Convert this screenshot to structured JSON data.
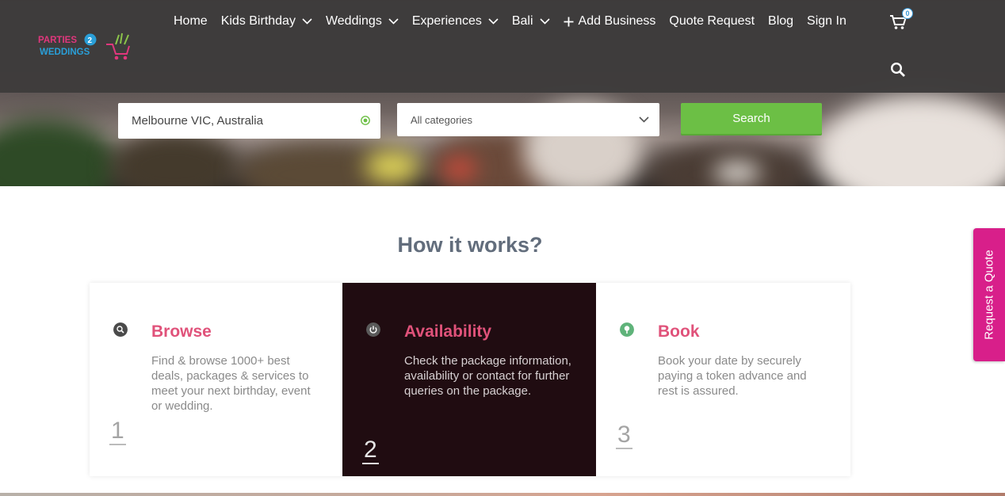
{
  "header": {
    "logo_top": "PARTIES",
    "logo_mid": "2",
    "logo_bottom": "WEDDINGS",
    "nav": [
      {
        "label": "Home",
        "dropdown": false
      },
      {
        "label": "Kids Birthday",
        "dropdown": true
      },
      {
        "label": "Weddings",
        "dropdown": true
      },
      {
        "label": "Experiences",
        "dropdown": true
      },
      {
        "label": "Bali",
        "dropdown": true
      },
      {
        "label": "Add Business",
        "dropdown": false,
        "icon": "plus-icon"
      },
      {
        "label": "Quote Request",
        "dropdown": false
      },
      {
        "label": "Blog",
        "dropdown": false
      },
      {
        "label": "Sign In",
        "dropdown": false
      }
    ],
    "cart_count": "0"
  },
  "search": {
    "location_value": "Melbourne VIC, Australia",
    "category_value": "All categories",
    "button_label": "Search"
  },
  "how_it_works": {
    "title": "How it works?",
    "steps": [
      {
        "title": "Browse",
        "text": "Find & browse 1000+ best deals, packages & services to meet your next birthday, event or wedding.",
        "number": "1",
        "icon": "search-icon"
      },
      {
        "title": "Availability",
        "text": "Check the package information, availability or contact for further queries on the package.",
        "number": "2",
        "icon": "power-icon"
      },
      {
        "title": "Book",
        "text": "Book your date by securely paying a token advance and rest is assured.",
        "number": "3",
        "icon": "tree-icon"
      }
    ]
  },
  "side_tab": {
    "label": "Request a Quote"
  },
  "colors": {
    "accent_pink": "#e0527a",
    "search_green": "#6cbf45",
    "dark_card": "#200c11",
    "quote_tab": "#d81f8a"
  }
}
